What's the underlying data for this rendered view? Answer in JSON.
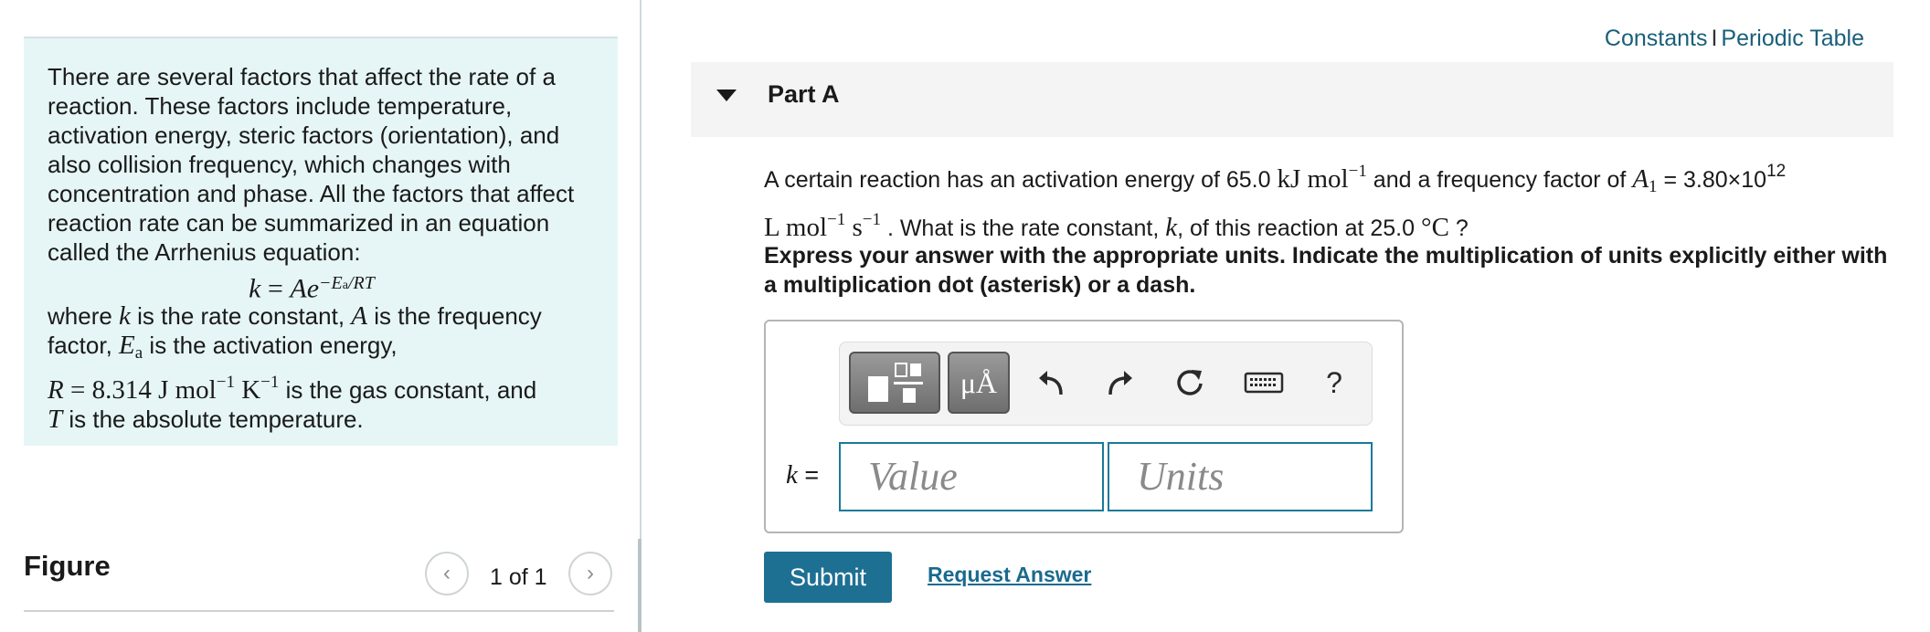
{
  "intro": {
    "line1": "There are several factors that affect the rate of a reaction. These factors include temperature, activation energy, steric factors (orientation), and also collision frequency, which changes with concentration and phase. All the factors that affect reaction rate can be summarized in an equation called the Arrhenius equation:",
    "eq_k": "k",
    "eq_eq": " = ",
    "eq_A": "Ae",
    "eq_exp": "−E",
    "eq_exp_sub": "a",
    "eq_exp_tail": "/RT",
    "where_1": "where ",
    "k": "k",
    "where_2": " is the rate constant, ",
    "A": "A",
    "where_3": " is the frequency factor, ",
    "E": "E",
    "a": "a",
    "where_4": " is the activation energy,",
    "R": "R",
    "r_eq": " = 8.314 J mol",
    "r_exp1": "−1",
    "r_K": " K",
    "r_exp2": "−1",
    "where_5": " is the gas constant, and",
    "T": "T",
    "where_6": " is the absolute temperature."
  },
  "figure": {
    "label": "Figure",
    "pager": "1 of 1",
    "prev": "‹",
    "next": "›"
  },
  "links": {
    "constants": "Constants",
    "sep": "I",
    "periodic": "Periodic Table"
  },
  "part": {
    "title": "Part A"
  },
  "question": {
    "q1": "A certain reaction has an activation energy of 65.0 ",
    "kJ": "kJ mol",
    "m1": "−1",
    "q2": " and a frequency factor of ",
    "A1": "A",
    "A1sub": "1",
    "q3": " = 3.80×10",
    "e12": "12",
    "L": "L mol",
    "m2": "−1",
    "s": " s",
    "m3": "−1",
    "q4": " . What is the rate constant, ",
    "k": "k",
    "q5": ", of this reaction at 25.0 ",
    "degC": "°C",
    "q6": " ?"
  },
  "instructions": "Express your answer with the appropriate units. Indicate the multiplication of units explicitly either with a multiplication dot (asterisk) or a dash.",
  "answer": {
    "k_label": "k",
    "k_eq": " =",
    "value_placeholder": "Value",
    "units_placeholder": "Units",
    "units_btn": "μÅ",
    "help": "?"
  },
  "actions": {
    "submit": "Submit",
    "request": "Request Answer"
  },
  "colors": {
    "intro_bg": "#e6f5f6",
    "link": "#1a5f7a",
    "submit_bg": "#1e7093",
    "input_border": "#1a7a9a"
  }
}
